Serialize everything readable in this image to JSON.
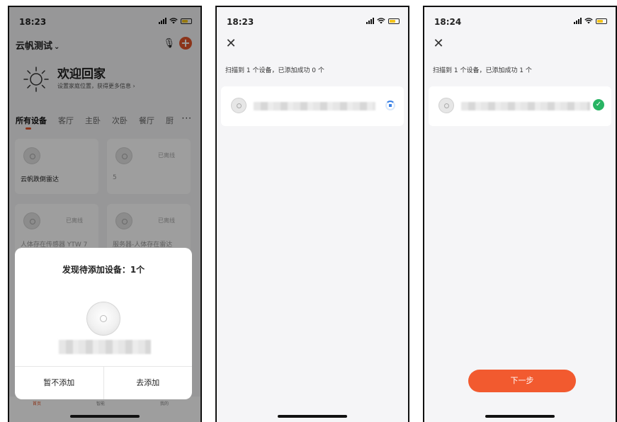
{
  "screen1": {
    "status": {
      "time": "18:23"
    },
    "home_name": "云帆测试",
    "welcome_title": "欢迎回家",
    "welcome_subtitle": "设置家庭位置，获得更多信息",
    "tabs": [
      "所有设备",
      "客厅",
      "主卧",
      "次卧",
      "餐厅",
      "厨"
    ],
    "devices": [
      {
        "name": "云帆跌倒雷达",
        "status": ""
      },
      {
        "name": "5",
        "status": "已离线"
      },
      {
        "name": "人体存在传感器 YTW 7",
        "status": "已离线"
      },
      {
        "name": "服务器-人体存在雷达",
        "status": "已离线"
      }
    ],
    "nav": [
      "首页",
      "智能",
      "我的"
    ],
    "dialog": {
      "title": "发现待添加设备：1个",
      "cancel_label": "暂不添加",
      "confirm_label": "去添加"
    }
  },
  "screen2": {
    "status": {
      "time": "18:23"
    },
    "scan_info": "扫描到 1 个设备，已添加成功 0 个"
  },
  "screen3": {
    "status": {
      "time": "18:24"
    },
    "scan_info": "扫描到 1 个设备，已添加成功 1 个",
    "next_label": "下一步"
  },
  "colors": {
    "accent": "#f25a2f",
    "success": "#28b463",
    "loading": "#3b82e6"
  }
}
